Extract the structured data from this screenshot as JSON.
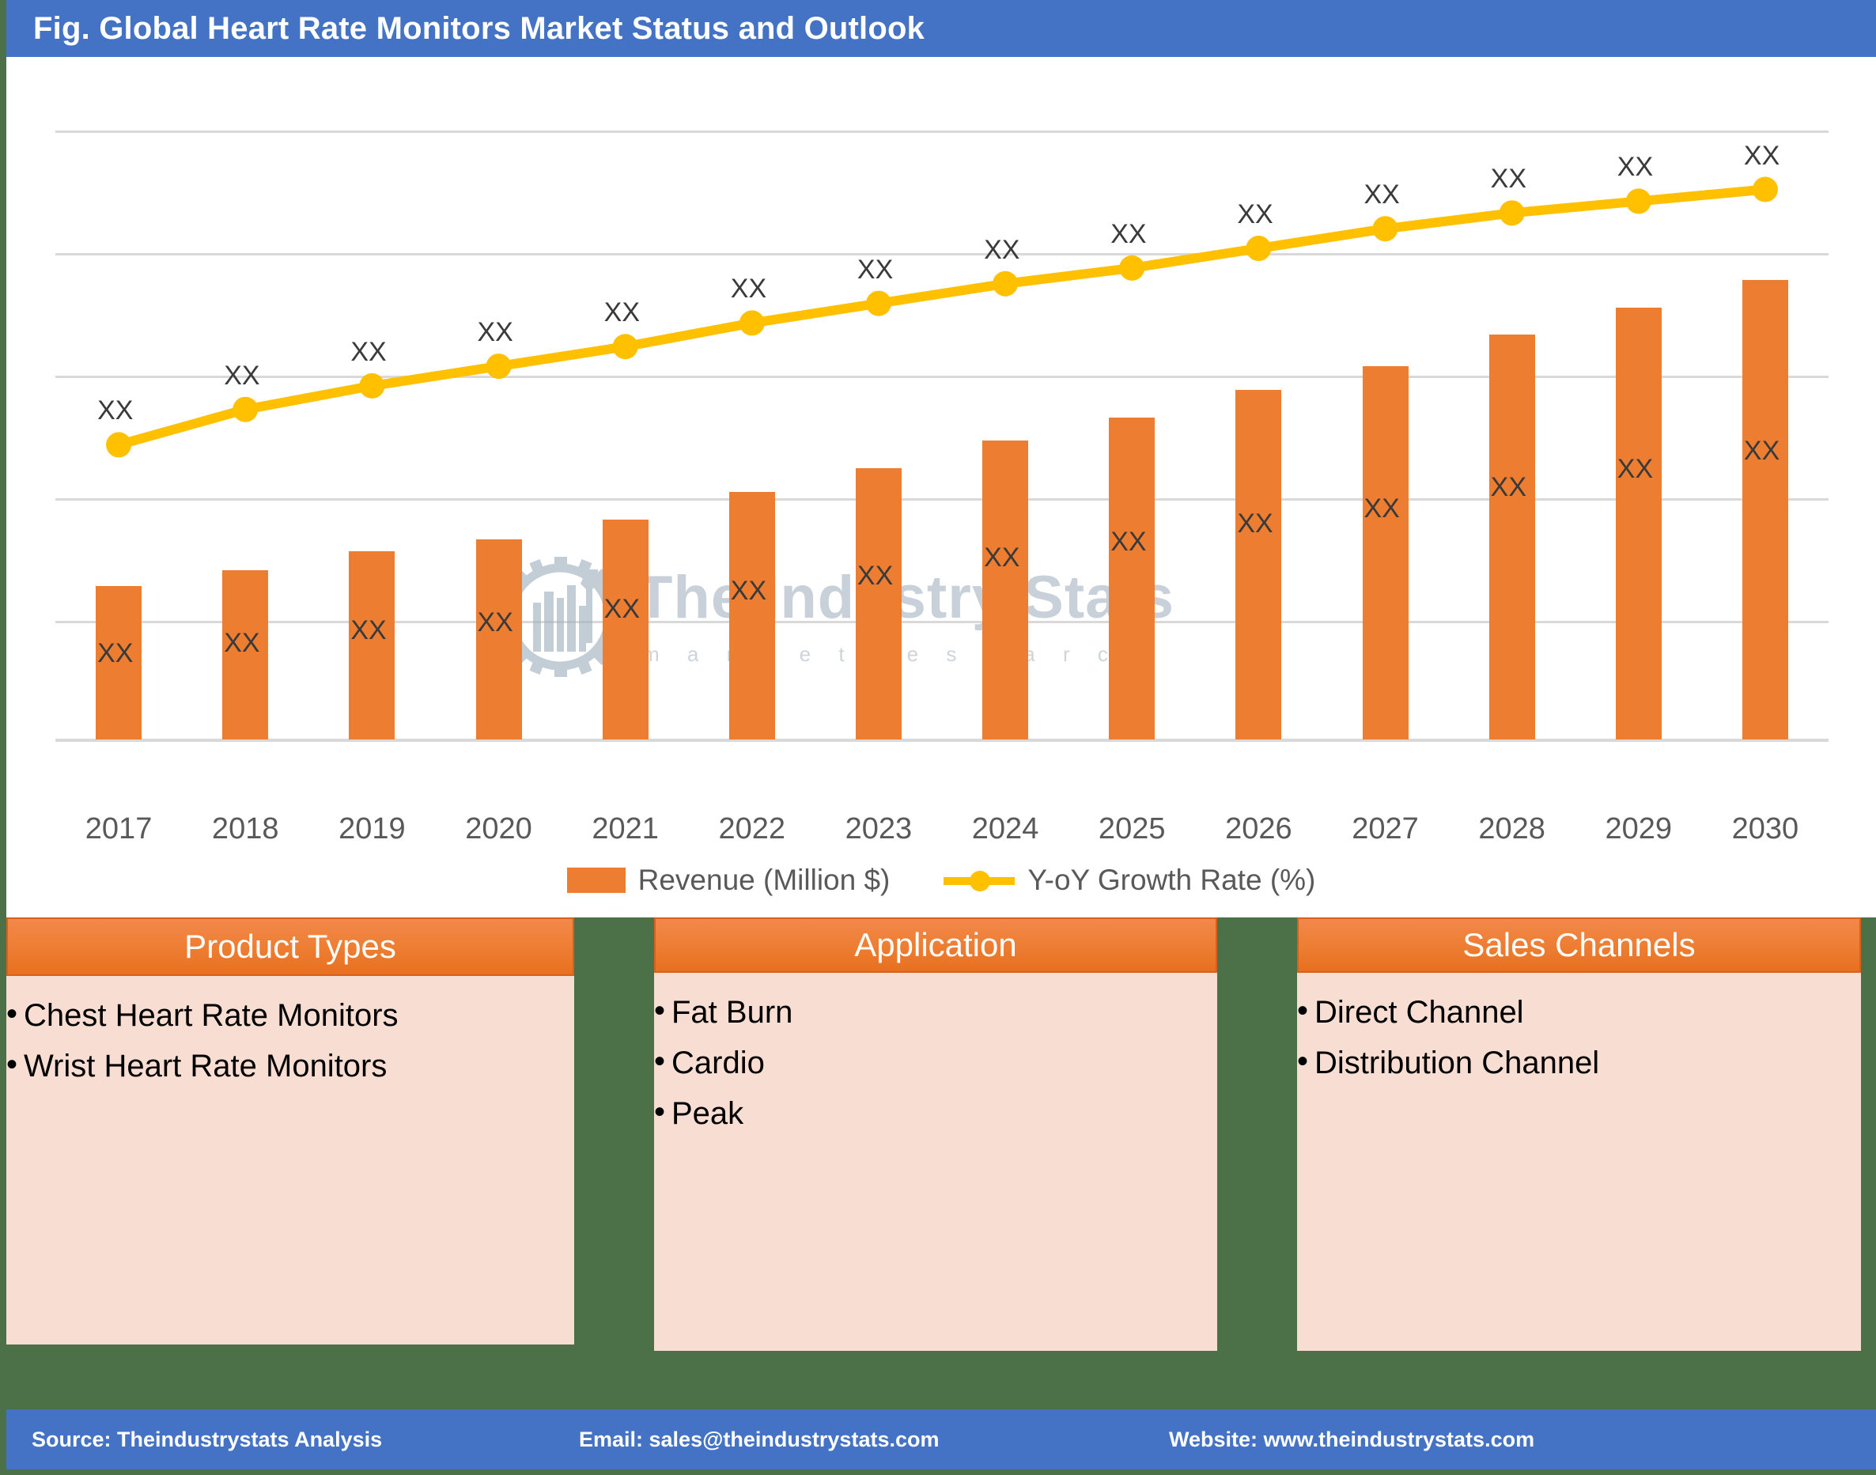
{
  "header": {
    "title": "Fig. Global Heart Rate Monitors Market Status and Outlook"
  },
  "watermark": {
    "title": "The Industry Stats",
    "subtitle": "m a r k e t   r e s e a r c h"
  },
  "chart_data": {
    "type": "bar",
    "title": "Fig. Global Heart Rate Monitors Market Status and Outlook",
    "xlabel": "",
    "ylabel": "",
    "grid": true,
    "legend_position": "bottom",
    "categories": [
      "2017",
      "2018",
      "2019",
      "2020",
      "2021",
      "2022",
      "2023",
      "2024",
      "2025",
      "2026",
      "2027",
      "2028",
      "2029",
      "2030"
    ],
    "series": [
      {
        "name": "Revenue (Million $)",
        "type": "bar",
        "color": "#ED7D31",
        "values": [
          39,
          43,
          48,
          51,
          56,
          63,
          69,
          76,
          82,
          89,
          95,
          103,
          110,
          117
        ],
        "data_labels": [
          "XX",
          "XX",
          "XX",
          "XX",
          "XX",
          "XX",
          "XX",
          "XX",
          "XX",
          "XX",
          "XX",
          "XX",
          "XX",
          "XX"
        ]
      },
      {
        "name": "Y-oY Growth Rate (%)",
        "type": "line",
        "color": "#FFC000",
        "values": [
          75,
          84,
          90,
          95,
          100,
          106,
          111,
          116,
          120,
          125,
          130,
          134,
          137,
          140
        ],
        "data_labels": [
          "XX",
          "XX",
          "XX",
          "XX",
          "XX",
          "XX",
          "XX",
          "XX",
          "XX",
          "XX",
          "XX",
          "XX",
          "XX",
          "XX"
        ]
      }
    ],
    "ylim": [
      0,
      155
    ]
  },
  "legend": {
    "bar_label": "Revenue (Million $)",
    "line_label": "Y-oY Growth Rate (%)"
  },
  "boxes": [
    {
      "id": "product",
      "title": "Product Types",
      "items": [
        "Chest Heart Rate Monitors",
        "Wrist Heart Rate Monitors"
      ]
    },
    {
      "id": "application",
      "title": "Application",
      "items": [
        "Fat Burn",
        "Cardio",
        "Peak"
      ]
    },
    {
      "id": "sales",
      "title": "Sales Channels",
      "items": [
        "Direct Channel",
        "Distribution Channel"
      ]
    }
  ],
  "footer": {
    "source": "Source: Theindustrystats Analysis",
    "email": "Email: sales@theindustrystats.com",
    "website": "Website: www.theindustrystats.com"
  },
  "colors": {
    "header_blue": "#4472C4",
    "frame_green": "#4C7047",
    "bar_orange": "#ED7D31",
    "line_yellow": "#FFC000",
    "box_body_pink": "#F8DED2"
  }
}
